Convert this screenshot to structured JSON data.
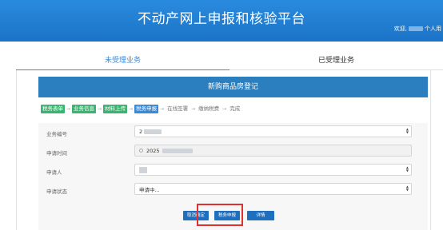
{
  "header": {
    "title": "不动产网上申报和核验平台",
    "welcome_prefix": "欢迎,",
    "welcome_suffix": "个人用"
  },
  "tabs": [
    {
      "label": "未受理业务",
      "active": true
    },
    {
      "label": "已受理业务",
      "active": false
    }
  ],
  "form": {
    "title": "新购商品房登记",
    "steps": [
      {
        "label": "税务表单",
        "state": "done"
      },
      {
        "label": "业务信息",
        "state": "done"
      },
      {
        "label": "材料上传",
        "state": "done"
      },
      {
        "label": "税务申报",
        "state": "current"
      },
      {
        "label": "在线签署",
        "state": "todo"
      },
      {
        "label": "缴纳税费",
        "state": "todo"
      },
      {
        "label": "完成",
        "state": "todo"
      }
    ],
    "fields": {
      "business_no": {
        "label": "业务编号",
        "value": "2"
      },
      "apply_time": {
        "label": "申请时间",
        "value": "2025"
      },
      "applicant": {
        "label": "申请人",
        "value": ""
      },
      "status": {
        "label": "申请状态",
        "value": "申请中..."
      }
    },
    "buttons": {
      "cancel_confirm": "取消确定",
      "tax_declare": "税务申报",
      "detail": "详情"
    }
  },
  "colors": {
    "header_blue": "#1b73c6",
    "form_header_blue": "#2b7fbf",
    "step_done_green": "#3cb371",
    "step_current_blue": "#3a8ad8",
    "highlight_red": "#e03030"
  }
}
